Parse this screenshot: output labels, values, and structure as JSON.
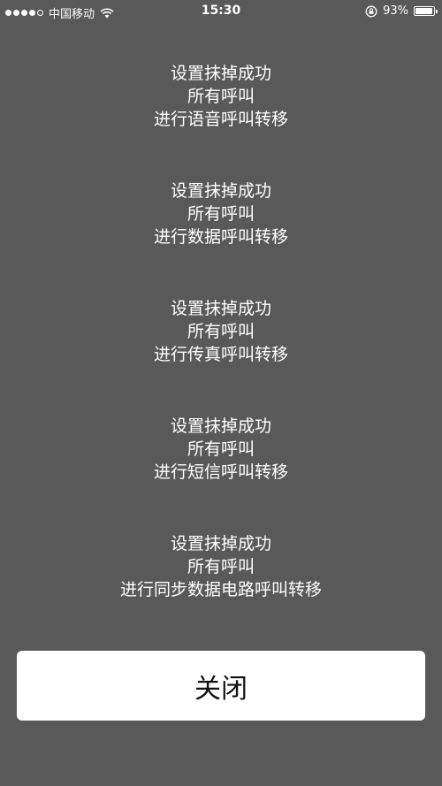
{
  "status_bar": {
    "signal_dots": [
      true,
      true,
      true,
      true,
      false
    ],
    "carrier": "中国移动",
    "time": "15:30",
    "battery_percent": "93%",
    "battery_level": 0.93,
    "icons": [
      "signal-icon",
      "wifi-icon",
      "rotation-lock-icon",
      "battery-icon"
    ]
  },
  "messages": [
    {
      "lines": [
        "设置抹掉成功",
        "所有呼叫",
        "进行语音呼叫转移"
      ]
    },
    {
      "lines": [
        "设置抹掉成功",
        "所有呼叫",
        "进行数据呼叫转移"
      ]
    },
    {
      "lines": [
        "设置抹掉成功",
        "所有呼叫",
        "进行传真呼叫转移"
      ]
    },
    {
      "lines": [
        "设置抹掉成功",
        "所有呼叫",
        "进行短信呼叫转移"
      ]
    },
    {
      "lines": [
        "设置抹掉成功",
        "所有呼叫",
        "进行同步数据电路呼叫转移"
      ]
    }
  ],
  "close_button": {
    "label": "关闭"
  },
  "colors": {
    "background": "#595959",
    "text": "#ffffff",
    "button_background": "#ffffff",
    "button_text": "#111111"
  }
}
